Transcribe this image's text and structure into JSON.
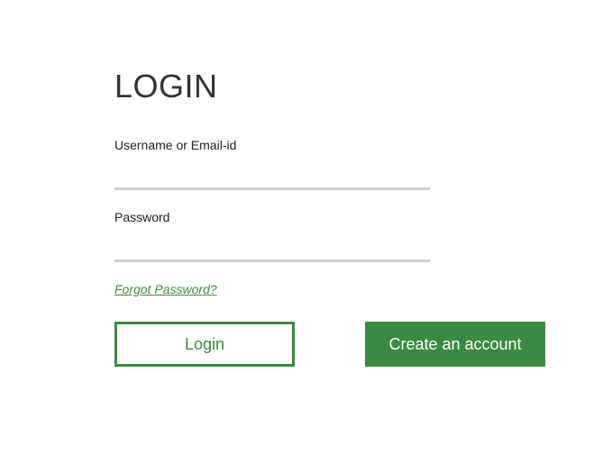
{
  "form": {
    "title": "LOGIN",
    "username_label": "Username or Email-id",
    "username_value": "",
    "password_label": "Password",
    "password_value": "",
    "forgot_link": "Forgot Password?",
    "login_button": "Login",
    "create_account_button": "Create an account"
  },
  "colors": {
    "accent": "#3a8a41",
    "input_underline": "#cfcfcf",
    "text": "#333333"
  }
}
